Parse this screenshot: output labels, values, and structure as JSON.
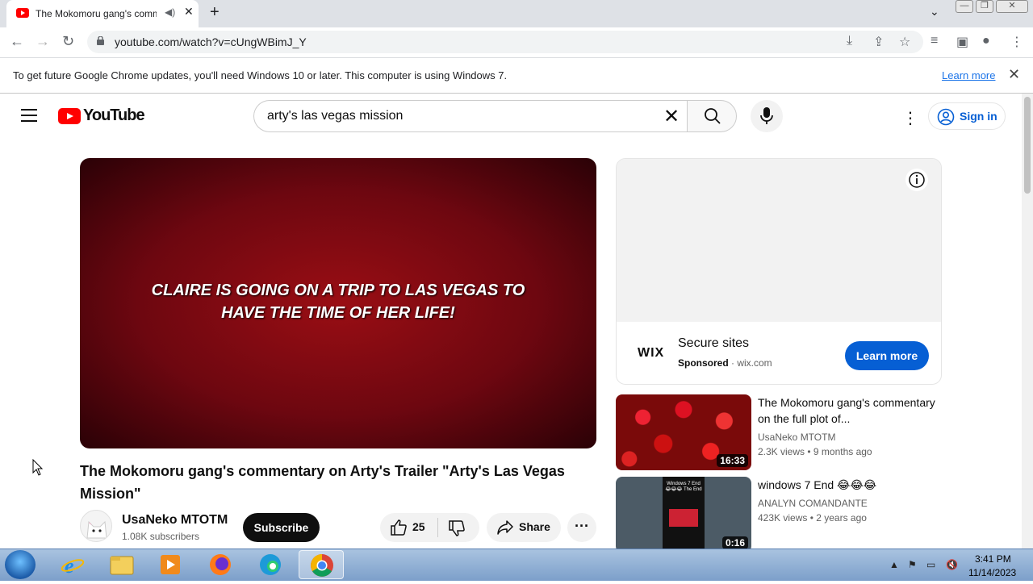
{
  "browser": {
    "tab_title": "The Mokomoru gang's comm",
    "url": "youtube.com/watch?v=cUngWBimJ_Y",
    "new_tab": "+",
    "close_tab": "✕"
  },
  "infobar": {
    "message": "To get future Google Chrome updates, you'll need Windows 10 or later. This computer is using Windows 7.",
    "learn_more": "Learn more",
    "close": "✕"
  },
  "youtube": {
    "wordmark": "YouTube",
    "search_query": "arty's las vegas mission",
    "sign_in": "Sign in"
  },
  "video": {
    "caption_line1": "CLAIRE IS GOING ON A TRIP TO LAS VEGAS TO",
    "caption_line2": "HAVE THE TIME OF HER LIFE!",
    "title": "The Mokomoru gang's commentary on Arty's Trailer \"Arty's Las Vegas Mission\"",
    "channel": "UsaNeko MTOTM",
    "subscribers": "1.08K subscribers",
    "subscribe": "Subscribe",
    "likes": "25",
    "share": "Share",
    "more": "···"
  },
  "ad": {
    "brand": "WIX",
    "headline": "Secure sites",
    "sponsored": "Sponsored",
    "domain": "· wix.com",
    "cta": "Learn more"
  },
  "recommendations": [
    {
      "title": "The Mokomoru gang's commentary on the full plot of...",
      "channel": "UsaNeko MTOTM",
      "meta": "2.3K views • 9 months ago",
      "duration": "16:33"
    },
    {
      "title": "windows 7 End 😂😂😂",
      "channel": "ANALYN COMANDANTE",
      "meta": "423K views • 2 years ago",
      "duration": "0:16"
    }
  ],
  "rec_thumb2_text": "Windows 7 End 😂😂😂 The End",
  "taskbar": {
    "time": "3:41 PM",
    "date": "11/14/2023"
  },
  "colors": {
    "yt_red": "#ff0000",
    "link_blue": "#065fd4",
    "chrome_blue": "#1a73e8"
  }
}
